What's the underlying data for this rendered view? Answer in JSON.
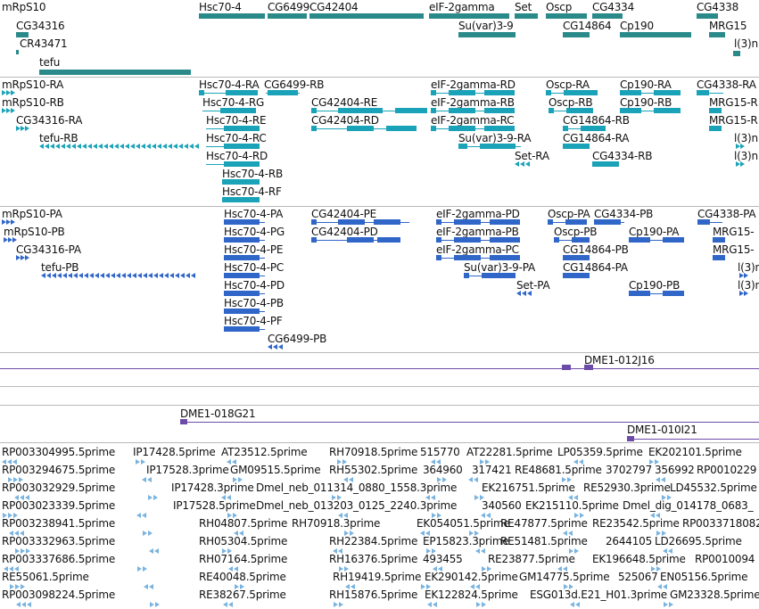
{
  "colors": {
    "gene": "#2a8a8a",
    "transcript_ra": "#1aa3b8",
    "transcript_pa": "#2f66c8",
    "clone": "#6d4ba8",
    "est": "#7ab3df",
    "separator": "#b9b9b9"
  },
  "gene_track": {
    "labels": [
      "mRpS10",
      "CG34316",
      "CR43471",
      "tefu",
      "Hsc70-4",
      "CG6499",
      "CG42404",
      "eIF-2gamma",
      "Set",
      "Oscp",
      "CG4334",
      "CG4338",
      "Su(var)3-9",
      "CG14864",
      "Cp190",
      "MRG15",
      "l(3)n"
    ]
  },
  "transcript_ra_track": {
    "labels": [
      "mRpS10-RA",
      "mRpS10-RB",
      "CG34316-RA",
      "tefu-RB",
      "Hsc70-4-RA",
      "CG6499-RB",
      "Hsc70-4-RG",
      "Hsc70-4-RE",
      "Hsc70-4-RC",
      "Hsc70-4-RD",
      "Hsc70-4-RB",
      "Hsc70-4-RF",
      "CG42404-RE",
      "CG42404-RD",
      "eIF-2gamma-RD",
      "eIF-2gamma-RB",
      "eIF-2gamma-RC",
      "Su(var)3-9-RA",
      "Set-RA",
      "Oscp-RA",
      "Oscp-RB",
      "CG14864-RB",
      "CG14864-RA",
      "CG4334-RB",
      "Cp190-RA",
      "Cp190-RB",
      "CG4338-RA",
      "MRG15-R",
      "MRG15-R",
      "l(3)n",
      "l(3)n"
    ]
  },
  "transcript_pa_track": {
    "labels": [
      "mRpS10-PA",
      "mRpS10-PB",
      "CG34316-PA",
      "tefu-PB",
      "Hsc70-4-PA",
      "Hsc70-4-PG",
      "Hsc70-4-PE",
      "Hsc70-4-PC",
      "Hsc70-4-PD",
      "Hsc70-4-PB",
      "Hsc70-4-PF",
      "CG6499-PB",
      "CG42404-PE",
      "CG42404-PD",
      "eIF-2gamma-PD",
      "eIF-2gamma-PB",
      "eIF-2gamma-PC",
      "Su(var)3-9-PA",
      "Set-PA",
      "Oscp-PA",
      "CG4334-PB",
      "Oscp-PB",
      "CG14864-PB",
      "CG14864-PA",
      "Cp190-PA",
      "Cp190-PB",
      "CG4338-PA",
      "MRG15-",
      "MRG15-",
      "l(3)n",
      "l(3)n"
    ]
  },
  "clone_track": {
    "labels": [
      "DME1-012J16",
      "DME1-018G21",
      "DME1-010I21"
    ]
  },
  "est_track": {
    "labels": [
      "RP003304995.5prime",
      "IP17428.5prime",
      "AT23512.5prime",
      "RH70918.5prime",
      "515770",
      "AT22281.5prime",
      "LP05359.5prime",
      "EK202101.5prime",
      "RP003294675.5prime",
      "IP17528.3prime",
      "GM09515.5prime",
      "RH55302.5prime",
      "364960",
      "317421",
      "RE48681.5prime",
      "3702797",
      "356992",
      "RP0010229",
      "RP003032929.5prime",
      "IP17428.3prime",
      "Dmel_neb_011314_0880_1558.3prime",
      "EK216751.5prime",
      "RE52930.3prime",
      "LD45532.5prime",
      "RP003023339.5prime",
      "IP17528.5prime",
      "Dmel_neb_013203_0125_2240.3prime",
      "340560",
      "EK215110.5prime",
      "Dmel_dig_014178_0683_",
      "RP003238941.5prime",
      "RH04807.5prime",
      "RH70918.3prime",
      "EK054051.5prime",
      "RE47877.5prime",
      "RE23542.5prime",
      "RP0033718082",
      "RP003332963.5prime",
      "RH05304.5prime",
      "RH22384.5prime",
      "EP15823.3prime",
      "RE51481.5prime",
      "2644105",
      "LD26695.5prime",
      "RP003337686.5prime",
      "RH07164.5prime",
      "RH16376.5prime",
      "493455",
      "RE23877.5prime",
      "EK196648.5prime",
      "RP0010094",
      "RE55061.5prime",
      "RE40048.5prime",
      "RH19419.5prime",
      "EK290142.5prime",
      "GM14775.5prime",
      "525067",
      "EN05156.5prime",
      "RP003098224.5prime",
      "RE38267.5prime",
      "RH15876.5prime",
      "EK122824.5prime",
      "ESG013d.E21_H01.3prime",
      "GM23328.5prime"
    ]
  }
}
